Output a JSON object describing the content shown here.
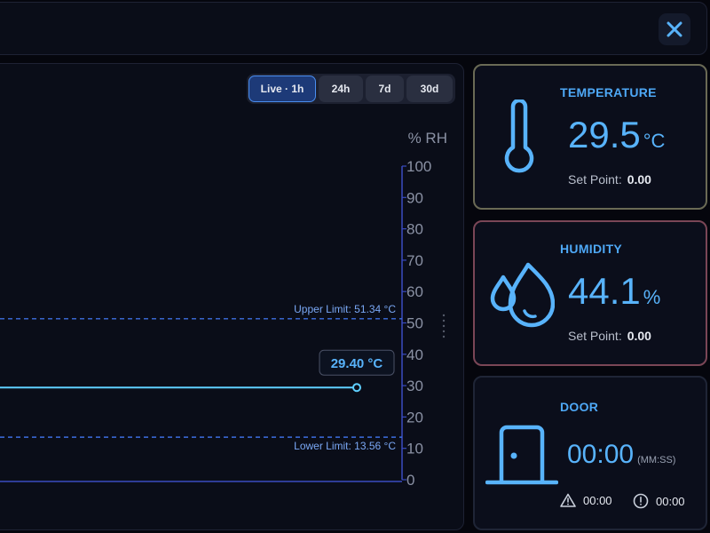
{
  "range_buttons": [
    {
      "label": "Live · 1h",
      "active": true
    },
    {
      "label": "24h",
      "active": false
    },
    {
      "label": "7d",
      "active": false
    },
    {
      "label": "30d",
      "active": false
    }
  ],
  "chart_data": {
    "type": "line",
    "y_axis": {
      "label": "% RH",
      "ticks": [
        0,
        10,
        20,
        30,
        40,
        50,
        60,
        70,
        80,
        90,
        100
      ],
      "ylim": [
        0,
        100
      ],
      "side": "right"
    },
    "upper_limit": {
      "label": "Upper Limit: 51.34 °C",
      "value": 51.34
    },
    "lower_limit": {
      "label": "Lower Limit: 13.56 °C",
      "value": 13.56
    },
    "series": [
      {
        "values": [
          29.4,
          29.4,
          29.4,
          29.4,
          29.4
        ],
        "current_label": "29.40 °C",
        "color": "#5fd0ff"
      }
    ],
    "grid": false
  },
  "temperature": {
    "title": "TEMPERATURE",
    "value": "29.5",
    "unit": "°C",
    "setpoint_label": "Set Point:",
    "setpoint_value": "0.00",
    "icon": "thermometer-icon"
  },
  "humidity": {
    "title": "HUMIDITY",
    "value": "44.1",
    "unit": "%",
    "setpoint_label": "Set Point:",
    "setpoint_value": "0.00",
    "icon": "water-drops-icon"
  },
  "door": {
    "title": "DOOR",
    "time": "00:00",
    "format": "(MM:SS)",
    "warning_time": "00:00",
    "alarm_time": "00:00",
    "icon": "door-icon"
  },
  "colors": {
    "accent": "#58b3fb",
    "temp_border": "#6a6a55",
    "hum_border": "#7a4656",
    "limit_line": "#3c6fe0"
  }
}
